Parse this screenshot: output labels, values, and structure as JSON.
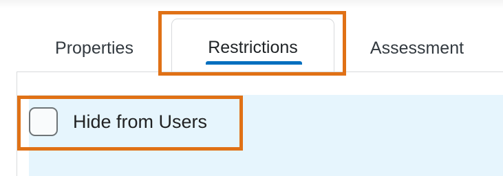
{
  "tabs": [
    {
      "label": "Properties",
      "active": false
    },
    {
      "label": "Restrictions",
      "active": true
    },
    {
      "label": "Assessment",
      "active": false
    }
  ],
  "restrictions": {
    "hide_from_users_label": "Hide from Users",
    "hide_from_users_checked": false
  },
  "colors": {
    "active_tab_indicator": "#006fbf",
    "panel_background": "#e6f5fd",
    "highlight_frame": "#e07116"
  }
}
